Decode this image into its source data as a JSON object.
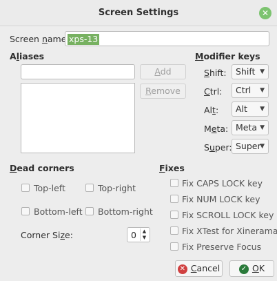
{
  "window": {
    "title": "Screen Settings"
  },
  "screen_name": {
    "label_pre": "Screen ",
    "label_key": "n",
    "label_post": "ame:",
    "value": "xps-13"
  },
  "aliases": {
    "header_pre": "A",
    "header_key": "l",
    "header_post": "iases",
    "input_value": "",
    "add_key": "A",
    "add_rest": "dd",
    "remove_key": "R",
    "remove_rest": "emove"
  },
  "modifier_keys": {
    "header_pre": "",
    "header_key": "M",
    "header_post": "odifier keys",
    "rows": [
      {
        "key": "S",
        "rest": "hift:",
        "lead": "",
        "value": "Shift"
      },
      {
        "key": "C",
        "rest": "trl:",
        "lead": "",
        "value": "Ctrl"
      },
      {
        "key": "t",
        "rest": ":",
        "lead": "Al",
        "value": "Alt"
      },
      {
        "key": "e",
        "rest": "ta:",
        "lead": "M",
        "value": "Meta"
      },
      {
        "key": "u",
        "rest": "per:",
        "lead": "S",
        "value": "Super"
      }
    ]
  },
  "dead_corners": {
    "header_key": "D",
    "header_post": "ead corners",
    "top_left": "Top-left",
    "top_right": "Top-right",
    "bottom_left": "Bottom-left",
    "bottom_right": "Bottom-right",
    "corner_size_pre": "Corner Si",
    "corner_size_key": "z",
    "corner_size_post": "e:",
    "corner_size_value": "0"
  },
  "fixes": {
    "header_key": "F",
    "header_post": "ixes",
    "items": [
      "Fix CAPS LOCK key",
      "Fix NUM LOCK key",
      "Fix SCROLL LOCK key",
      "Fix XTest for Xinerama",
      "Fix Preserve Focus"
    ]
  },
  "buttons": {
    "cancel_key": "C",
    "cancel_rest": "ancel",
    "ok_key": "O",
    "ok_rest": "K"
  },
  "colors": {
    "selection": "#77b161",
    "close": "#7cc36f",
    "cancel_icon": "#d04040",
    "ok_icon": "#2a7a3a"
  }
}
